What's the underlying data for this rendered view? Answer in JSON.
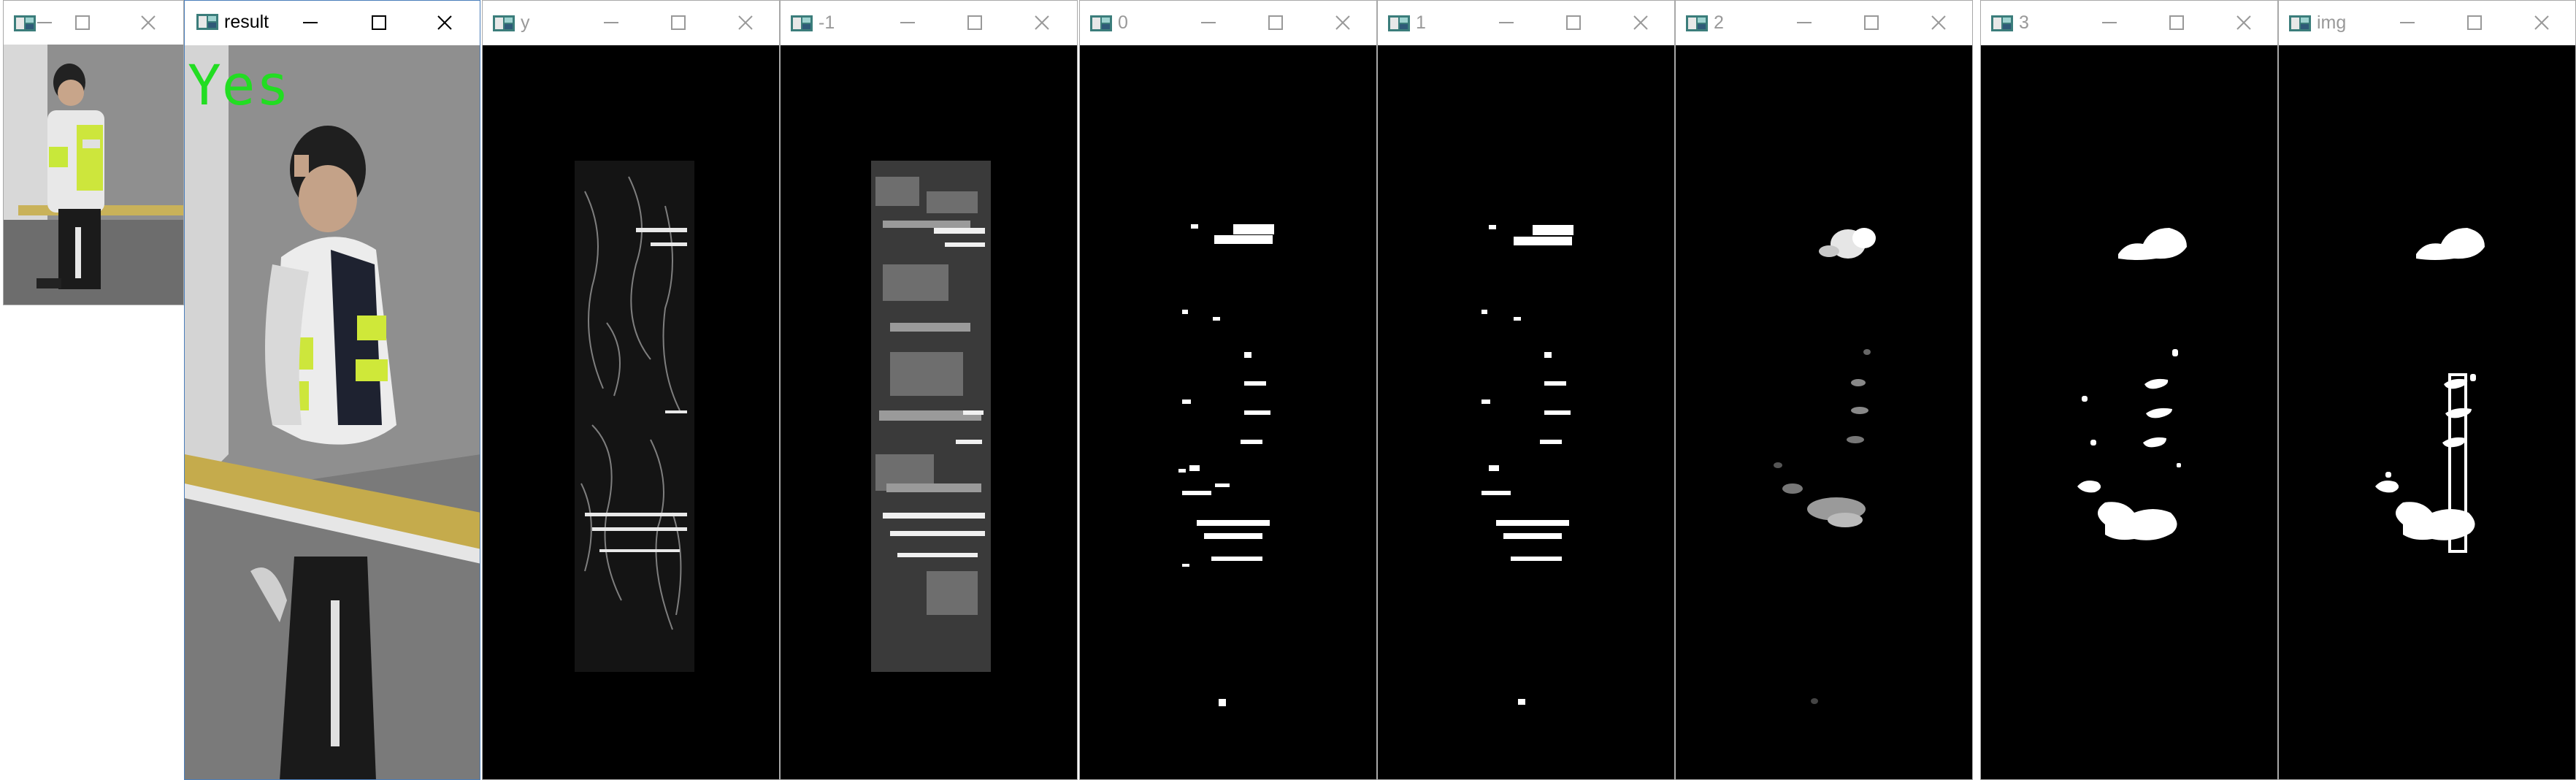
{
  "windows": [
    {
      "id": "small",
      "title": "",
      "active": false
    },
    {
      "id": "result",
      "title": "result",
      "active": true,
      "overlay_text": "Yes",
      "overlay_color": "#22dd22"
    },
    {
      "id": "y",
      "title": "y",
      "active": false
    },
    {
      "id": "m1",
      "title": "-1",
      "active": false
    },
    {
      "id": "w0",
      "title": "0",
      "active": false
    },
    {
      "id": "w1",
      "title": "1",
      "active": false
    },
    {
      "id": "w2",
      "title": "2",
      "active": false
    },
    {
      "id": "w3",
      "title": "3",
      "active": false
    },
    {
      "id": "img",
      "title": "img",
      "active": false
    }
  ],
  "icons": {
    "app": "opencv-window-icon",
    "minimize": "minimize-icon",
    "maximize": "maximize-icon",
    "close": "close-icon"
  },
  "colors": {
    "border": "#a8a8a8",
    "active_border": "#4a7ebb",
    "image_background": "#000000",
    "inactive_title": "#999999"
  }
}
